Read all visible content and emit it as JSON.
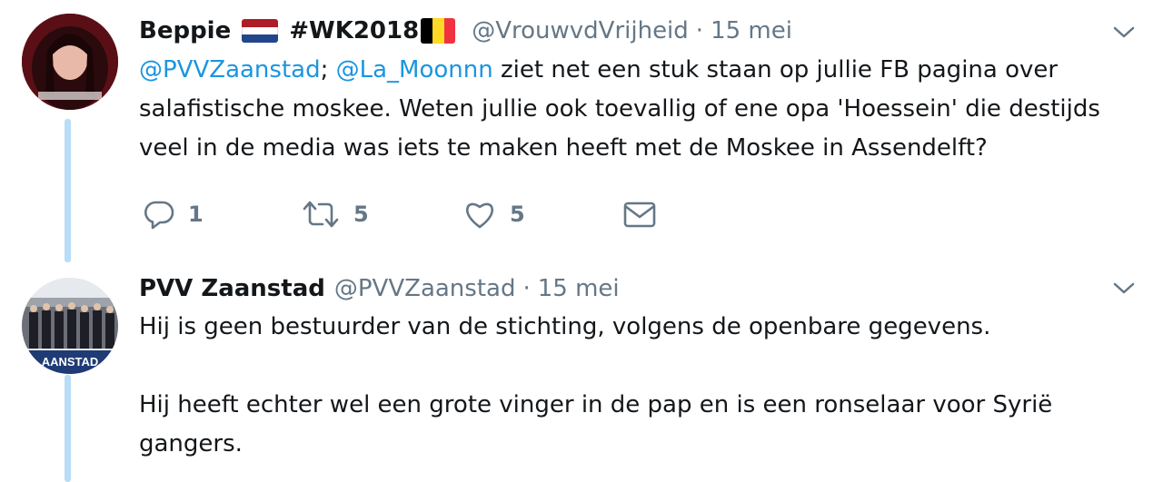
{
  "tweets": [
    {
      "name": "Beppie",
      "name_suffix": "#WK2018",
      "handle": "@VrouwvdVrijheid",
      "dot": "·",
      "time": "15 mei",
      "mention1": "@PVVZaanstad",
      "sep": ";",
      "mention2": "@La_Moonnn",
      "text": " ziet net een stuk staan op jullie FB pagina over salafistische moskee. Weten jullie ook toevallig of ene opa 'Hoessein' die destijds veel in de media was iets te maken heeft met de Moskee in Assendelft?",
      "replies": "1",
      "retweets": "5",
      "likes": "5",
      "flags": {
        "nl": [
          "#ae1c28",
          "#ffffff",
          "#21468b"
        ],
        "be": [
          "#000000",
          "#fdda24",
          "#ef3340"
        ]
      }
    },
    {
      "name": "PVV Zaanstad",
      "handle": "@PVVZaanstad",
      "dot": "·",
      "time": "15 mei",
      "para1": "Hij is geen bestuurder van de stichting, volgens de openbare gegevens.",
      "para2": "Hij heeft echter wel een grote vinger in de pap en is een ronselaar voor Syrië gangers.",
      "avatar_text": "AANSTAD"
    }
  ],
  "colors": {
    "mention": "#1b95e0",
    "meta": "#657786",
    "thread": "#b9dcf7"
  }
}
